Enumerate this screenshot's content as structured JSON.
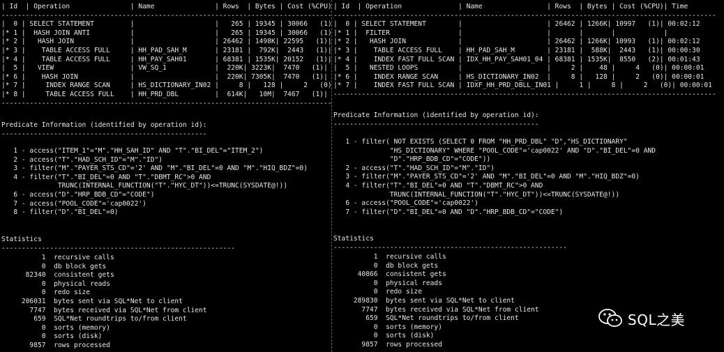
{
  "left": {
    "plan": "| Id  | Operation               | Name               | Rows  | Bytes | Cost (%CPU)|\n-------------------------------------------------------------------------------------\n|  0 | SELECT STATEMENT         |                    |   265 | 19345 | 30066   (1)|\n|* 1 |  HASH JOIN ANTI          |                    |   265 | 19345 | 30066   (1)|\n|* 2 |   HASH JOIN              |                    | 26462 | 1498K| 22595   (1)|\n|* 3 |    TABLE ACCESS FULL     | HH_PAD_SAH_M       | 23181 |  792K|  2443   (1)|\n|* 4 |    TABLE ACCESS FULL     | HH_PAY_SAH01       | 68381 | 1535K| 20152   (1)|\n|  5 |   VIEW                   | VW_SQ_1            |  220K| 3223K|  7470   (1)|\n|* 6 |    HASH JOIN             |                    |  220K| 7305K|  7470   (1)|\n|* 7 |     INDEX RANGE SCAN     | HS_DICTIONARY_IN02 |     8 |   128 |     2   (0)|\n|* 8 |     TABLE ACCESS FULL    | HH_PRD_DBL         |  614K|   10M|  7467   (1)|\n-------------------------------------------------------------------------------------",
    "predicate_title": "Predicate Information (identified by operation id):\n---------------------------------------------------",
    "predicates": "   1 - access(\"ITEM_1\"=\"M\".\"HH_SAH_ID\" AND \"T\".\"BI_DEL\"=\"ITEM_2\")\n   2 - access(\"T\".\"HAD_SCH_ID\"=\"M\".\"ID\")\n   3 - filter(\"M\".\"PAYER_STS_CD\"='2' AND \"M\".\"BI_DEL\"=0 AND \"M\".\"HIQ_BDZ\"=0)\n   4 - filter(\"T\".\"BI_DEL\"=0 AND \"T\".\"DBMT_RC\">0 AND\n              TRUNC(INTERNAL_FUNCTION(\"T\".\"HYC_DT\"))<=TRUNC(SYSDATE@!))\n   6 - access(\"D\".\"HRP_BDB_CD\"=\"CODE\")\n   7 - access(\"POOL_CODE\"='cap0022')\n   8 - filter(\"D\".\"BI_DEL\"=0)",
    "stats_title": "Statistics\n----------------------------------------------------------",
    "stats": "          1  recursive calls\n          0  db block gets\n      82340  consistent gets\n          0  physical reads\n          0  redo size\n     206031  bytes sent via SQL*Net to client\n       7747  bytes received via SQL*Net from client\n        659  SQL*Net roundtrips to/from client\n          0  sorts (memory)\n          0  sorts (disk)\n       9857  rows processed"
  },
  "right": {
    "plan": "| Id  | Operation              | Name                | Rows  | Bytes | Cost (%CPU)| Time\n-----------------------------------------------------------------------------------------------\n|  0 | SELECT STATEMENT        |                     | 26462 | 1266K| 10997   (1)| 00:02:12\n|* 1 |  FILTER                 |                     |       |       |            |\n|* 2 |   HASH JOIN             |                     | 26462 | 1266K| 10993   (1)| 00:02:12\n|* 3 |    TABLE ACCESS FULL    | HH_PAD_SAH_M        | 23181 |  588K|  2443   (1)| 00:00:30\n|* 4 |    INDEX FAST FULL SCAN | IDX_HH_PAY_SAH01_04 | 68381 | 1535K|  8550   (2)| 00:01:43\n|  5 |   NESTED LOOPS          |                     |     2 |    48 |     4   (0)| 00:00:01\n|* 6 |    INDEX RANGE SCAN     | HS_DICTIONARY_IN02  |     8 |   128 |     2   (0)| 00:00:01\n|* 7 |    INDEX FAST FULL SCAN | IDXF_HH_PRD_DBLL_IN01 |     1 |     8 |     2   (0)| 00:00:01\n-----------------------------------------------------------------------------------------------",
    "predicate_title": "Predicate Information (identified by operation id):\n---------------------------------------------------",
    "predicates": "   1 - filter( NOT EXISTS (SELECT 0 FROM \"HH_PRD_DBL\" \"D\",\"HS_DICTIONARY\"\n              \"HS_DICTIONARY\" WHERE \"POOL_CODE\"='cap0022' AND \"D\".\"BI_DEL\"=0 AND\n              \"D\".\"HRP_BDB_CD\"=\"CODE\"))\n   2 - access(\"T\".\"HAD_SCH_ID\"=\"M\".\"ID\")\n   3 - filter(\"M\".\"PAYER_STS_CD\"='2' AND \"M\".\"BI_DEL\"=0 AND \"M\".\"HIQ_BDZ\"=0)\n   4 - filter(\"T\".\"BI_DEL\"=0 AND \"T\".\"DBMT_RC\">0 AND\n              TRUNC(INTERNAL_FUNCTION(\"T\".\"HYC_DT\"))<=TRUNC(SYSDATE@!))\n   6 - access(\"POOL_CODE\"='cap0022')\n   7 - filter(\"D\".\"BI_DEL\"=0 AND \"D\".\"HRP_BDB_CD\"=\"CODE\")",
    "stats_title": "Statistics\n----------------------------------------------------------",
    "stats": "          1  recursive calls\n          0  db block gets\n      40866  consistent gets\n          0  physical reads\n          0  redo size\n     289830  bytes sent via SQL*Net to client\n       7747  bytes received via SQL*Net from client\n        659  SQL*Net roundtrips to/from client\n          0  sorts (memory)\n          0  sorts (disk)\n       9857  rows processed"
  },
  "watermark": {
    "text": "SQL之美",
    "icon": "wechat-icon"
  }
}
